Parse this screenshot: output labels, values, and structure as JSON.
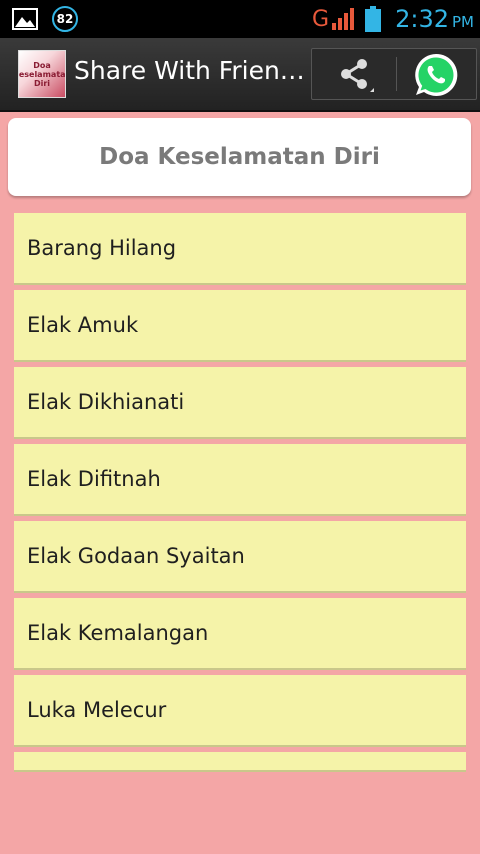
{
  "status_bar": {
    "notification_count": "82",
    "network_type": "G",
    "time": "2:32",
    "ampm": "PM"
  },
  "action_bar": {
    "title": "Share With Frien…",
    "app_icon_text": "Doa Keselamatan Diri"
  },
  "header": {
    "title": "Doa Keselamatan Diri"
  },
  "list": {
    "items": [
      {
        "label": "Barang Hilang"
      },
      {
        "label": "Elak Amuk"
      },
      {
        "label": "Elak Dikhianati"
      },
      {
        "label": "Elak Difitnah"
      },
      {
        "label": "Elak Godaan Syaitan"
      },
      {
        "label": "Elak Kemalangan"
      },
      {
        "label": "Luka Melecur"
      }
    ]
  },
  "colors": {
    "background": "#f4a6a6",
    "list_item": "#f5f3a9",
    "status_accent": "#33b5e5",
    "whatsapp": "#25d366"
  },
  "icons": [
    "image-icon",
    "notification-badge",
    "signal-icon",
    "battery-icon",
    "share-icon",
    "whatsapp-icon"
  ]
}
